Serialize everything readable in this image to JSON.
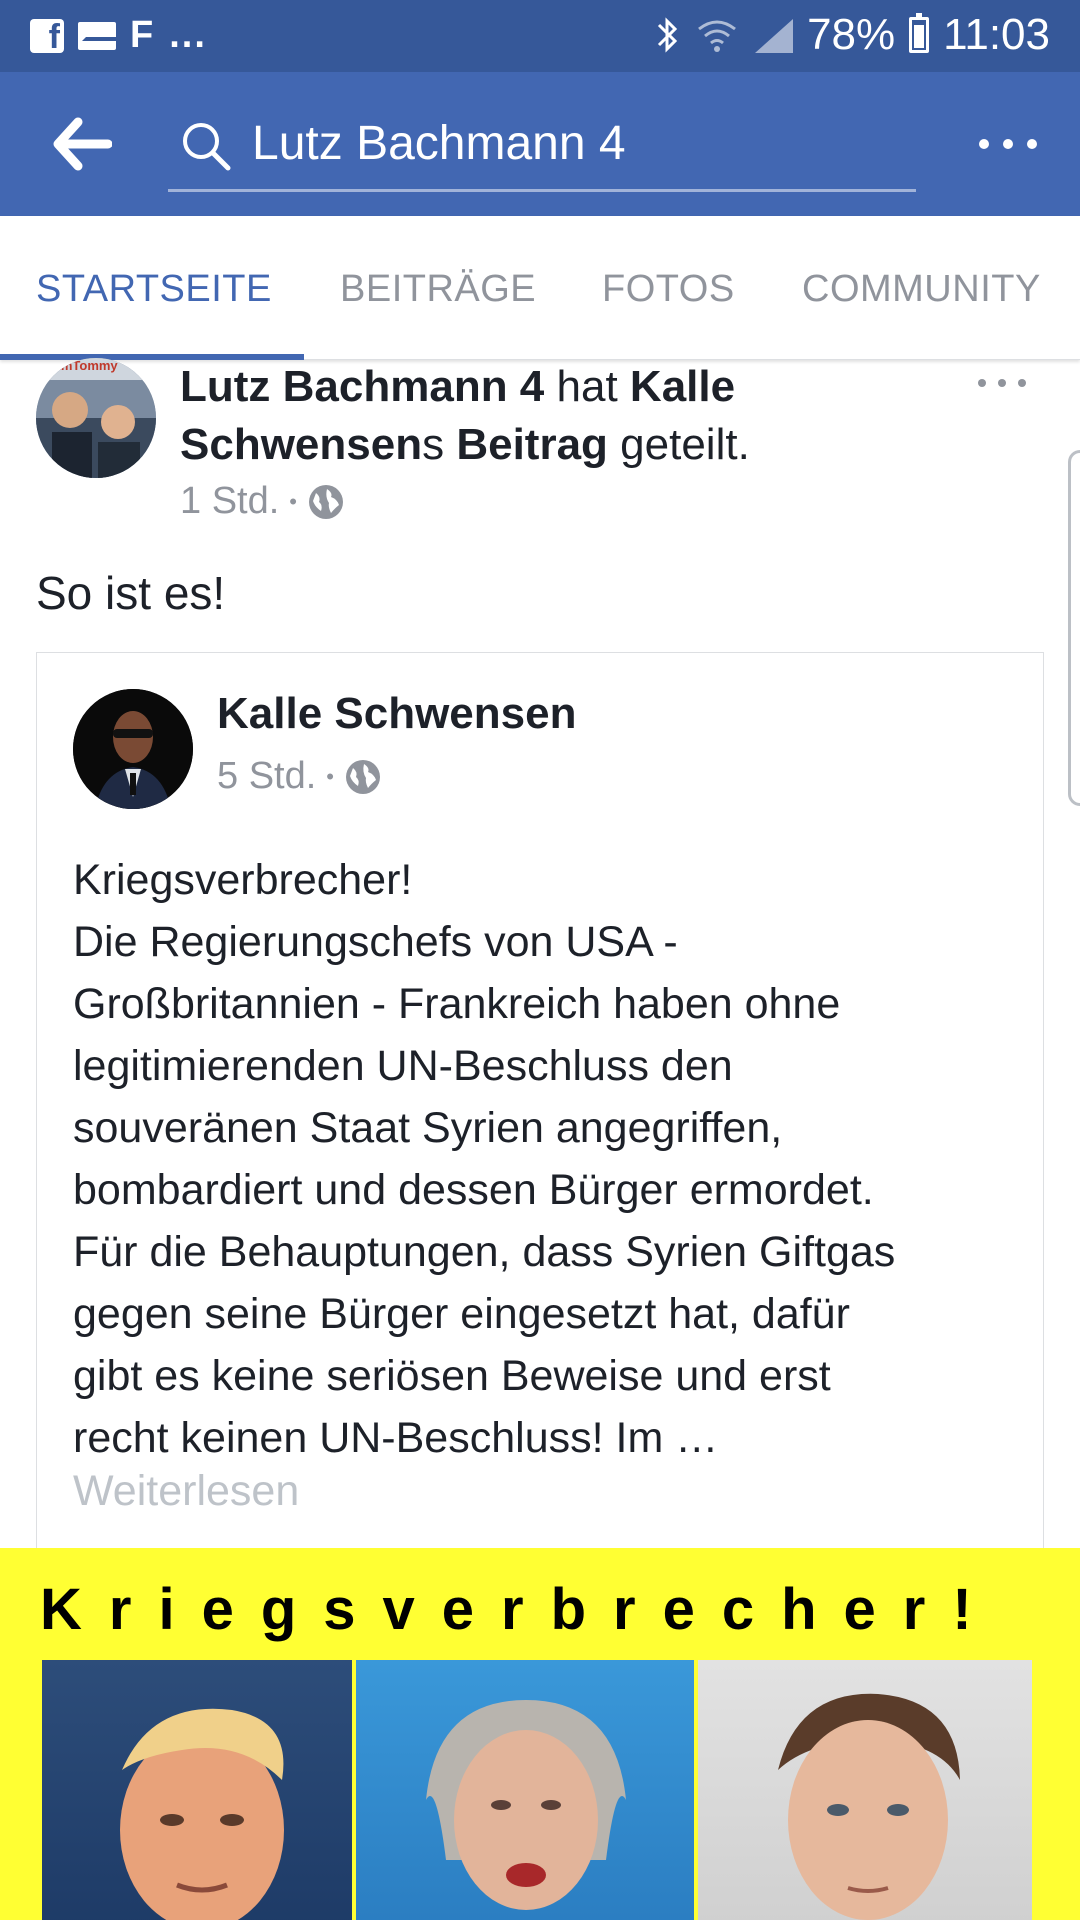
{
  "status_bar": {
    "left_label": "F",
    "left_ellipsis": "...",
    "battery": "78%",
    "time": "11:03",
    "icons": [
      "facebook-icon",
      "mail-icon",
      "bluetooth-icon",
      "wifi-icon",
      "signal-icon",
      "battery-icon"
    ]
  },
  "search": {
    "query": "Lutz Bachmann 4"
  },
  "tabs": [
    {
      "label": "STARTSEITE",
      "active": true
    },
    {
      "label": "BEITRÄGE",
      "active": false
    },
    {
      "label": "FOTOS",
      "active": false
    },
    {
      "label": "COMMUNITY",
      "active": false
    }
  ],
  "post": {
    "author": "Lutz Bachmann 4",
    "verb": "hat",
    "shared_from": "Kalle Schwensen",
    "shared_suffix": "s",
    "shared_object": "Beitrag",
    "action": "geteilt.",
    "time": "1 Std.",
    "dot": "•",
    "avatar_text": "iamTommy",
    "message": "So ist es!"
  },
  "shared_post": {
    "author": "Kalle Schwensen",
    "time": "5 Std.",
    "dot": "•",
    "body": "Kriegsverbrecher!\nDie Regierungschefs von USA -\nGroßbritannien - Frankreich haben ohne\nlegitimierenden UN-Beschluss den\nsouveränen Staat Syrien angegriffen,\nbombardiert und dessen Bürger ermordet.\nFür die Behauptungen, dass Syrien Giftgas\ngegen seine Bürger eingesetzt hat, dafür\ngibt es keine seriösen Beweise und erst\nrecht keinen UN-Beschluss! Im …",
    "read_more": "Weiterlesen"
  },
  "image": {
    "headline": "Kriegsverbrecher!",
    "background": "#ffff33"
  },
  "colors": {
    "brand": "#4267b2",
    "status_bar": "#365899",
    "muted": "#90949c",
    "text": "#1d2129"
  }
}
